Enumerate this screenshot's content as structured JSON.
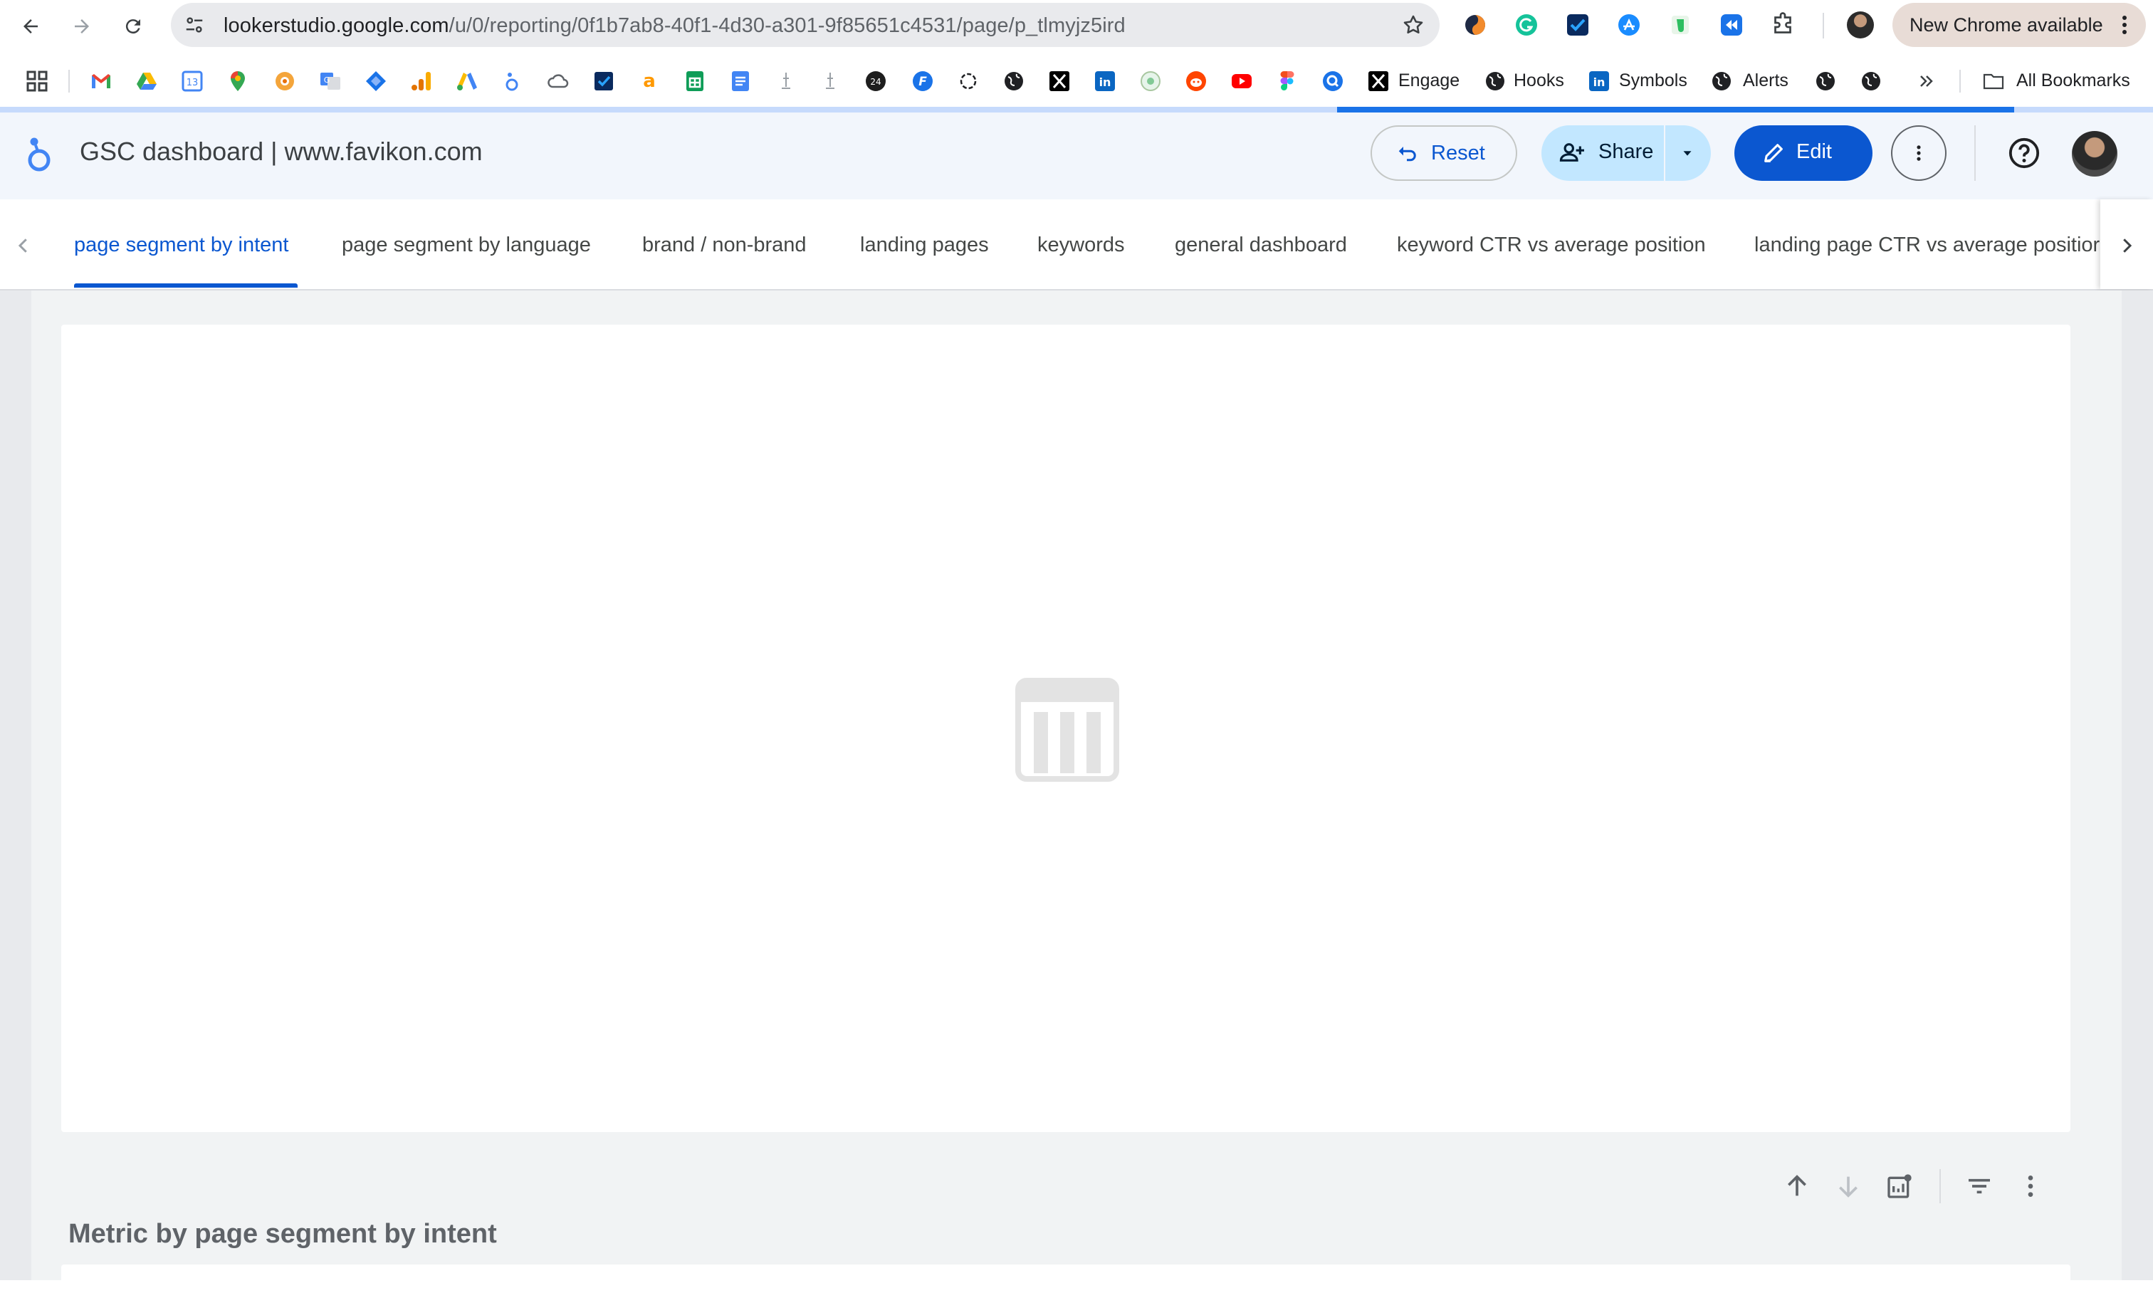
{
  "browser": {
    "url_domain": "lookerstudio.google.com",
    "url_path": "/u/0/reporting/0f1b7ab8-40f1-4d30-a301-9f85651c4531/page/p_tlmyjz5ird",
    "update_label": "New Chrome available",
    "bookmarks": {
      "engage": "Engage",
      "hooks": "Hooks",
      "symbols": "Symbols",
      "alerts": "Alerts",
      "all": "All Bookmarks"
    },
    "page_load_progress": 0.31
  },
  "report": {
    "title": "GSC dashboard | www.favikon.com",
    "reset_label": "Reset",
    "share_label": "Share",
    "edit_label": "Edit"
  },
  "tabs": [
    {
      "label": "page segment by intent",
      "active": true
    },
    {
      "label": "page segment by language"
    },
    {
      "label": "brand / non-brand"
    },
    {
      "label": "landing pages"
    },
    {
      "label": "keywords"
    },
    {
      "label": "general dashboard"
    },
    {
      "label": "keyword CTR vs average position"
    },
    {
      "label": "landing page CTR vs average positior"
    }
  ],
  "canvas": {
    "chart_title": "Metric by page segment by intent"
  },
  "colors": {
    "accent": "#0b57d0",
    "share_bg": "#c2e7ff",
    "header_bg": "#f2f6fc",
    "canvas_bg": "#f1f3f4"
  }
}
